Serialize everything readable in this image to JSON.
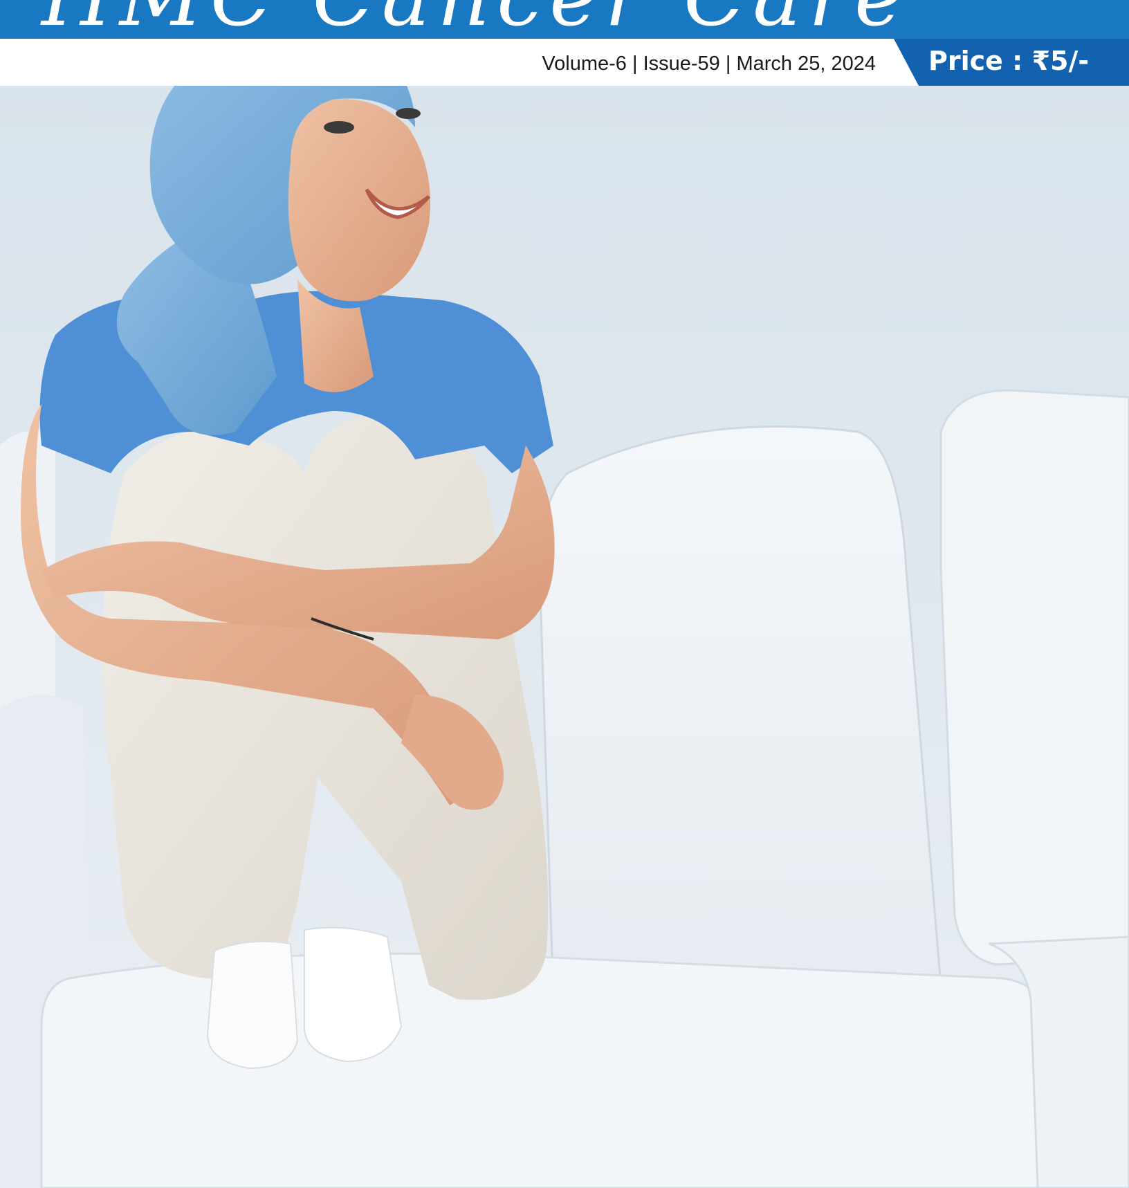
{
  "masthead": {
    "title": "HMC Cancer Care",
    "bar_color": "#1878c2"
  },
  "info_bar": {
    "volume": "Volume-6",
    "issue": "Issue-59",
    "date": "March 25, 2024",
    "separator": "|",
    "price_label": "Price :",
    "price_value": "₹5/-",
    "price_color": "#1262b0"
  },
  "cover_photo": {
    "subject": "woman-in-headscarf-on-sofa",
    "scarf_color": "#7aaed8",
    "shirt_color": "#4f8fd6"
  }
}
